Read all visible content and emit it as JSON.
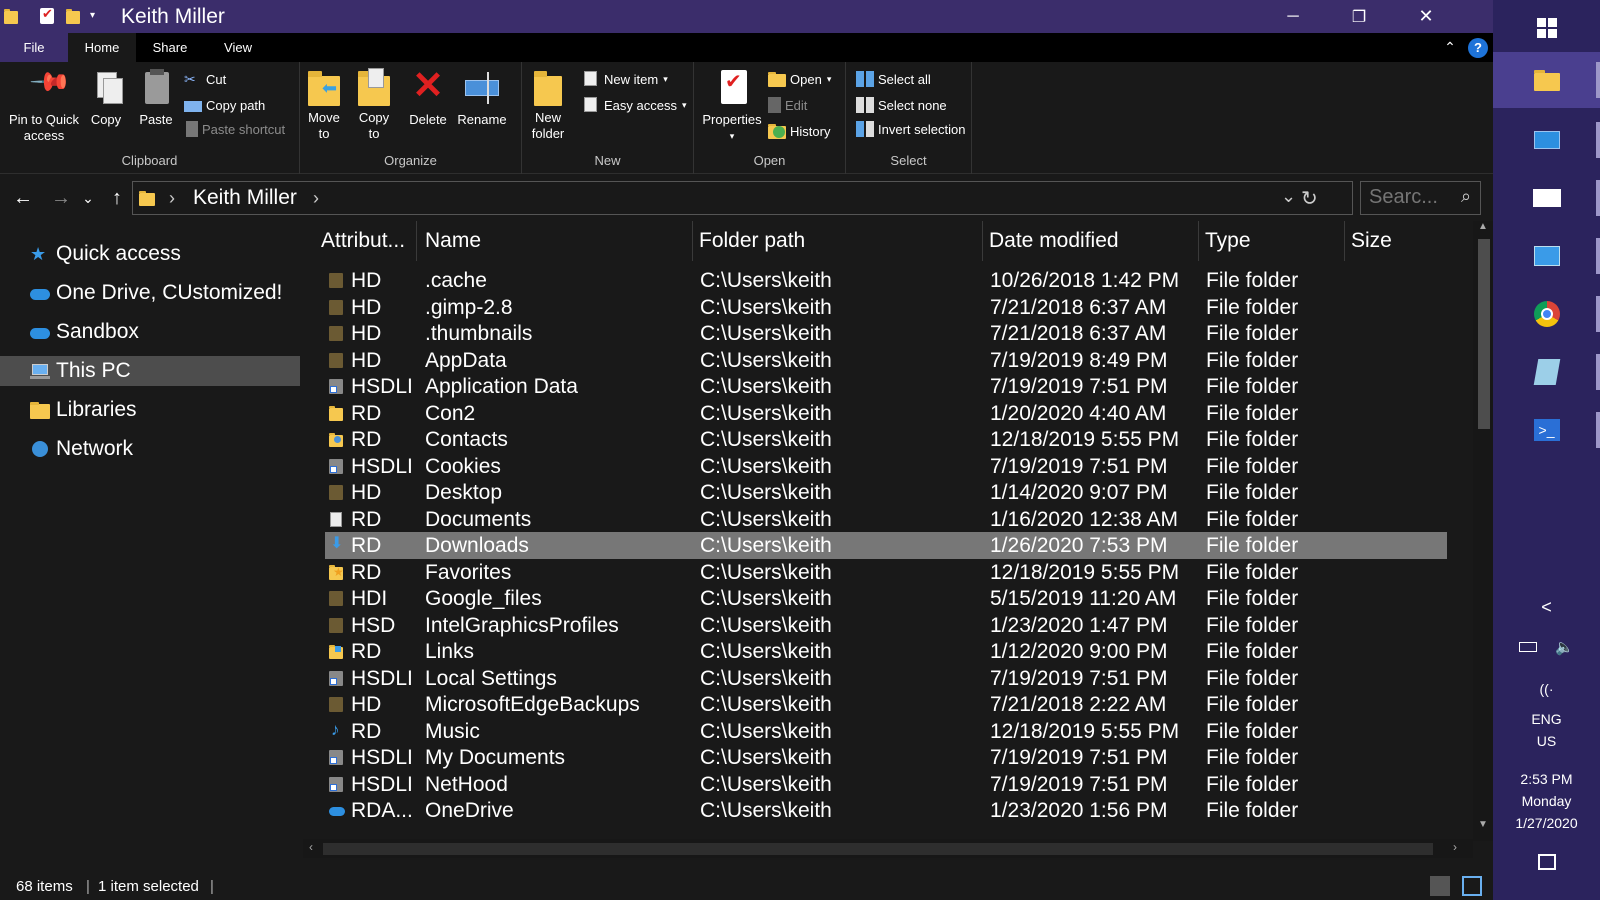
{
  "window": {
    "title": "Keith Miller",
    "controls": {
      "minimize": "─",
      "maximize": "❐",
      "close": "✕"
    },
    "help": "?",
    "collapse_ribbon": "⌃"
  },
  "tabs": [
    "File",
    "Home",
    "Share",
    "View"
  ],
  "ribbon": {
    "clipboard": {
      "label": "Clipboard",
      "pin": "Pin to Quick access",
      "copy": "Copy",
      "paste": "Paste",
      "cut": "Cut",
      "copy_path": "Copy path",
      "paste_shortcut": "Paste shortcut"
    },
    "organize": {
      "label": "Organize",
      "move_to": "Move to",
      "copy_to": "Copy to",
      "delete": "Delete",
      "rename": "Rename"
    },
    "new": {
      "label": "New",
      "new_folder": "New folder",
      "new_item": "New item",
      "easy_access": "Easy access"
    },
    "open": {
      "label": "Open",
      "properties": "Properties",
      "open": "Open",
      "edit": "Edit",
      "history": "History"
    },
    "select": {
      "label": "Select",
      "select_all": "Select all",
      "select_none": "Select none",
      "invert_selection": "Invert selection"
    }
  },
  "address": {
    "back": "←",
    "forward": "→",
    "recent": "⌄",
    "up": "↑",
    "breadcrumb": "Keith Miller",
    "breadcrumb_arrow": "›",
    "dropdown": "⌄",
    "refresh": "↻",
    "search_placeholder": "Searc...",
    "search_icon": "⌕"
  },
  "nav": [
    {
      "label": "Quick access",
      "icon": "star-icon"
    },
    {
      "label": "One Drive, CUstomized!",
      "icon": "cloud-icon"
    },
    {
      "label": "Sandbox",
      "icon": "cloud-icon"
    },
    {
      "label": "This PC",
      "icon": "computer-icon",
      "selected": true
    },
    {
      "label": "Libraries",
      "icon": "library-icon"
    },
    {
      "label": "Network",
      "icon": "network-icon"
    }
  ],
  "columns": [
    "Attribut...",
    "Name",
    "Folder path",
    "Date modified",
    "Type",
    "Size"
  ],
  "files": [
    {
      "attr": "HD",
      "name": ".cache",
      "path": "C:\\Users\\keith",
      "date": "10/26/2018 1:42 PM",
      "type": "File folder",
      "icon": "folder-dim"
    },
    {
      "attr": "HD",
      "name": ".gimp-2.8",
      "path": "C:\\Users\\keith",
      "date": "7/21/2018 6:37 AM",
      "type": "File folder",
      "icon": "folder-dim"
    },
    {
      "attr": "HD",
      "name": ".thumbnails",
      "path": "C:\\Users\\keith",
      "date": "7/21/2018 6:37 AM",
      "type": "File folder",
      "icon": "folder-dim"
    },
    {
      "attr": "HD",
      "name": "AppData",
      "path": "C:\\Users\\keith",
      "date": "7/19/2019 8:49 PM",
      "type": "File folder",
      "icon": "folder-dim"
    },
    {
      "attr": "HSDLI",
      "name": "Application Data",
      "path": "C:\\Users\\keith",
      "date": "7/19/2019 7:51 PM",
      "type": "File folder",
      "icon": "shortcut"
    },
    {
      "attr": "RD",
      "name": "Con2",
      "path": "C:\\Users\\keith",
      "date": "1/20/2020 4:40 AM",
      "type": "File folder",
      "icon": "folder"
    },
    {
      "attr": "RD",
      "name": "Contacts",
      "path": "C:\\Users\\keith",
      "date": "12/18/2019 5:55 PM",
      "type": "File folder",
      "icon": "contacts"
    },
    {
      "attr": "HSDLI",
      "name": "Cookies",
      "path": "C:\\Users\\keith",
      "date": "7/19/2019 7:51 PM",
      "type": "File folder",
      "icon": "shortcut"
    },
    {
      "attr": "HD",
      "name": "Desktop",
      "path": "C:\\Users\\keith",
      "date": "1/14/2020 9:07 PM",
      "type": "File folder",
      "icon": "folder-dim"
    },
    {
      "attr": "RD",
      "name": "Documents",
      "path": "C:\\Users\\keith",
      "date": "1/16/2020 12:38 AM",
      "type": "File folder",
      "icon": "documents"
    },
    {
      "attr": "RD",
      "name": "Downloads",
      "path": "C:\\Users\\keith",
      "date": "1/26/2020 7:53 PM",
      "type": "File folder",
      "icon": "downloads",
      "selected": true
    },
    {
      "attr": "RD",
      "name": "Favorites",
      "path": "C:\\Users\\keith",
      "date": "12/18/2019 5:55 PM",
      "type": "File folder",
      "icon": "favorites"
    },
    {
      "attr": "HDI",
      "name": "Google_files",
      "path": "C:\\Users\\keith",
      "date": "5/15/2019 11:20 AM",
      "type": "File folder",
      "icon": "folder-dim"
    },
    {
      "attr": "HSD",
      "name": "IntelGraphicsProfiles",
      "path": "C:\\Users\\keith",
      "date": "1/23/2020 1:47 PM",
      "type": "File folder",
      "icon": "folder-dim"
    },
    {
      "attr": "RD",
      "name": "Links",
      "path": "C:\\Users\\keith",
      "date": "1/12/2020 9:00 PM",
      "type": "File folder",
      "icon": "links"
    },
    {
      "attr": "HSDLI",
      "name": "Local Settings",
      "path": "C:\\Users\\keith",
      "date": "7/19/2019 7:51 PM",
      "type": "File folder",
      "icon": "shortcut"
    },
    {
      "attr": "HD",
      "name": "MicrosoftEdgeBackups",
      "path": "C:\\Users\\keith",
      "date": "7/21/2018 2:22 AM",
      "type": "File folder",
      "icon": "folder-dim"
    },
    {
      "attr": "RD",
      "name": "Music",
      "path": "C:\\Users\\keith",
      "date": "12/18/2019 5:55 PM",
      "type": "File folder",
      "icon": "music"
    },
    {
      "attr": "HSDLI",
      "name": "My Documents",
      "path": "C:\\Users\\keith",
      "date": "7/19/2019 7:51 PM",
      "type": "File folder",
      "icon": "shortcut"
    },
    {
      "attr": "HSDLI",
      "name": "NetHood",
      "path": "C:\\Users\\keith",
      "date": "7/19/2019 7:51 PM",
      "type": "File folder",
      "icon": "shortcut"
    },
    {
      "attr": "RDA...",
      "name": "OneDrive",
      "path": "C:\\Users\\keith",
      "date": "1/23/2020 1:56 PM",
      "type": "File folder",
      "icon": "onedrive"
    }
  ],
  "status": {
    "items": "68 items",
    "selected": "1 item selected"
  },
  "taskbar": {
    "apps": [
      "start-icon",
      "file-explorer-icon",
      "desktop-icon",
      "mail-icon",
      "remote-desktop-icon",
      "chrome-icon",
      "notepad-icon",
      "powershell-icon"
    ],
    "tray_expand": "<",
    "lang": "ENG",
    "region": "US",
    "time": "2:53 PM",
    "day": "Monday",
    "date": "1/27/2020"
  },
  "colors": {
    "titlebar": "#3b2d6b",
    "taskbar": "#2b235d",
    "background": "#191919",
    "selection": "#777777"
  }
}
